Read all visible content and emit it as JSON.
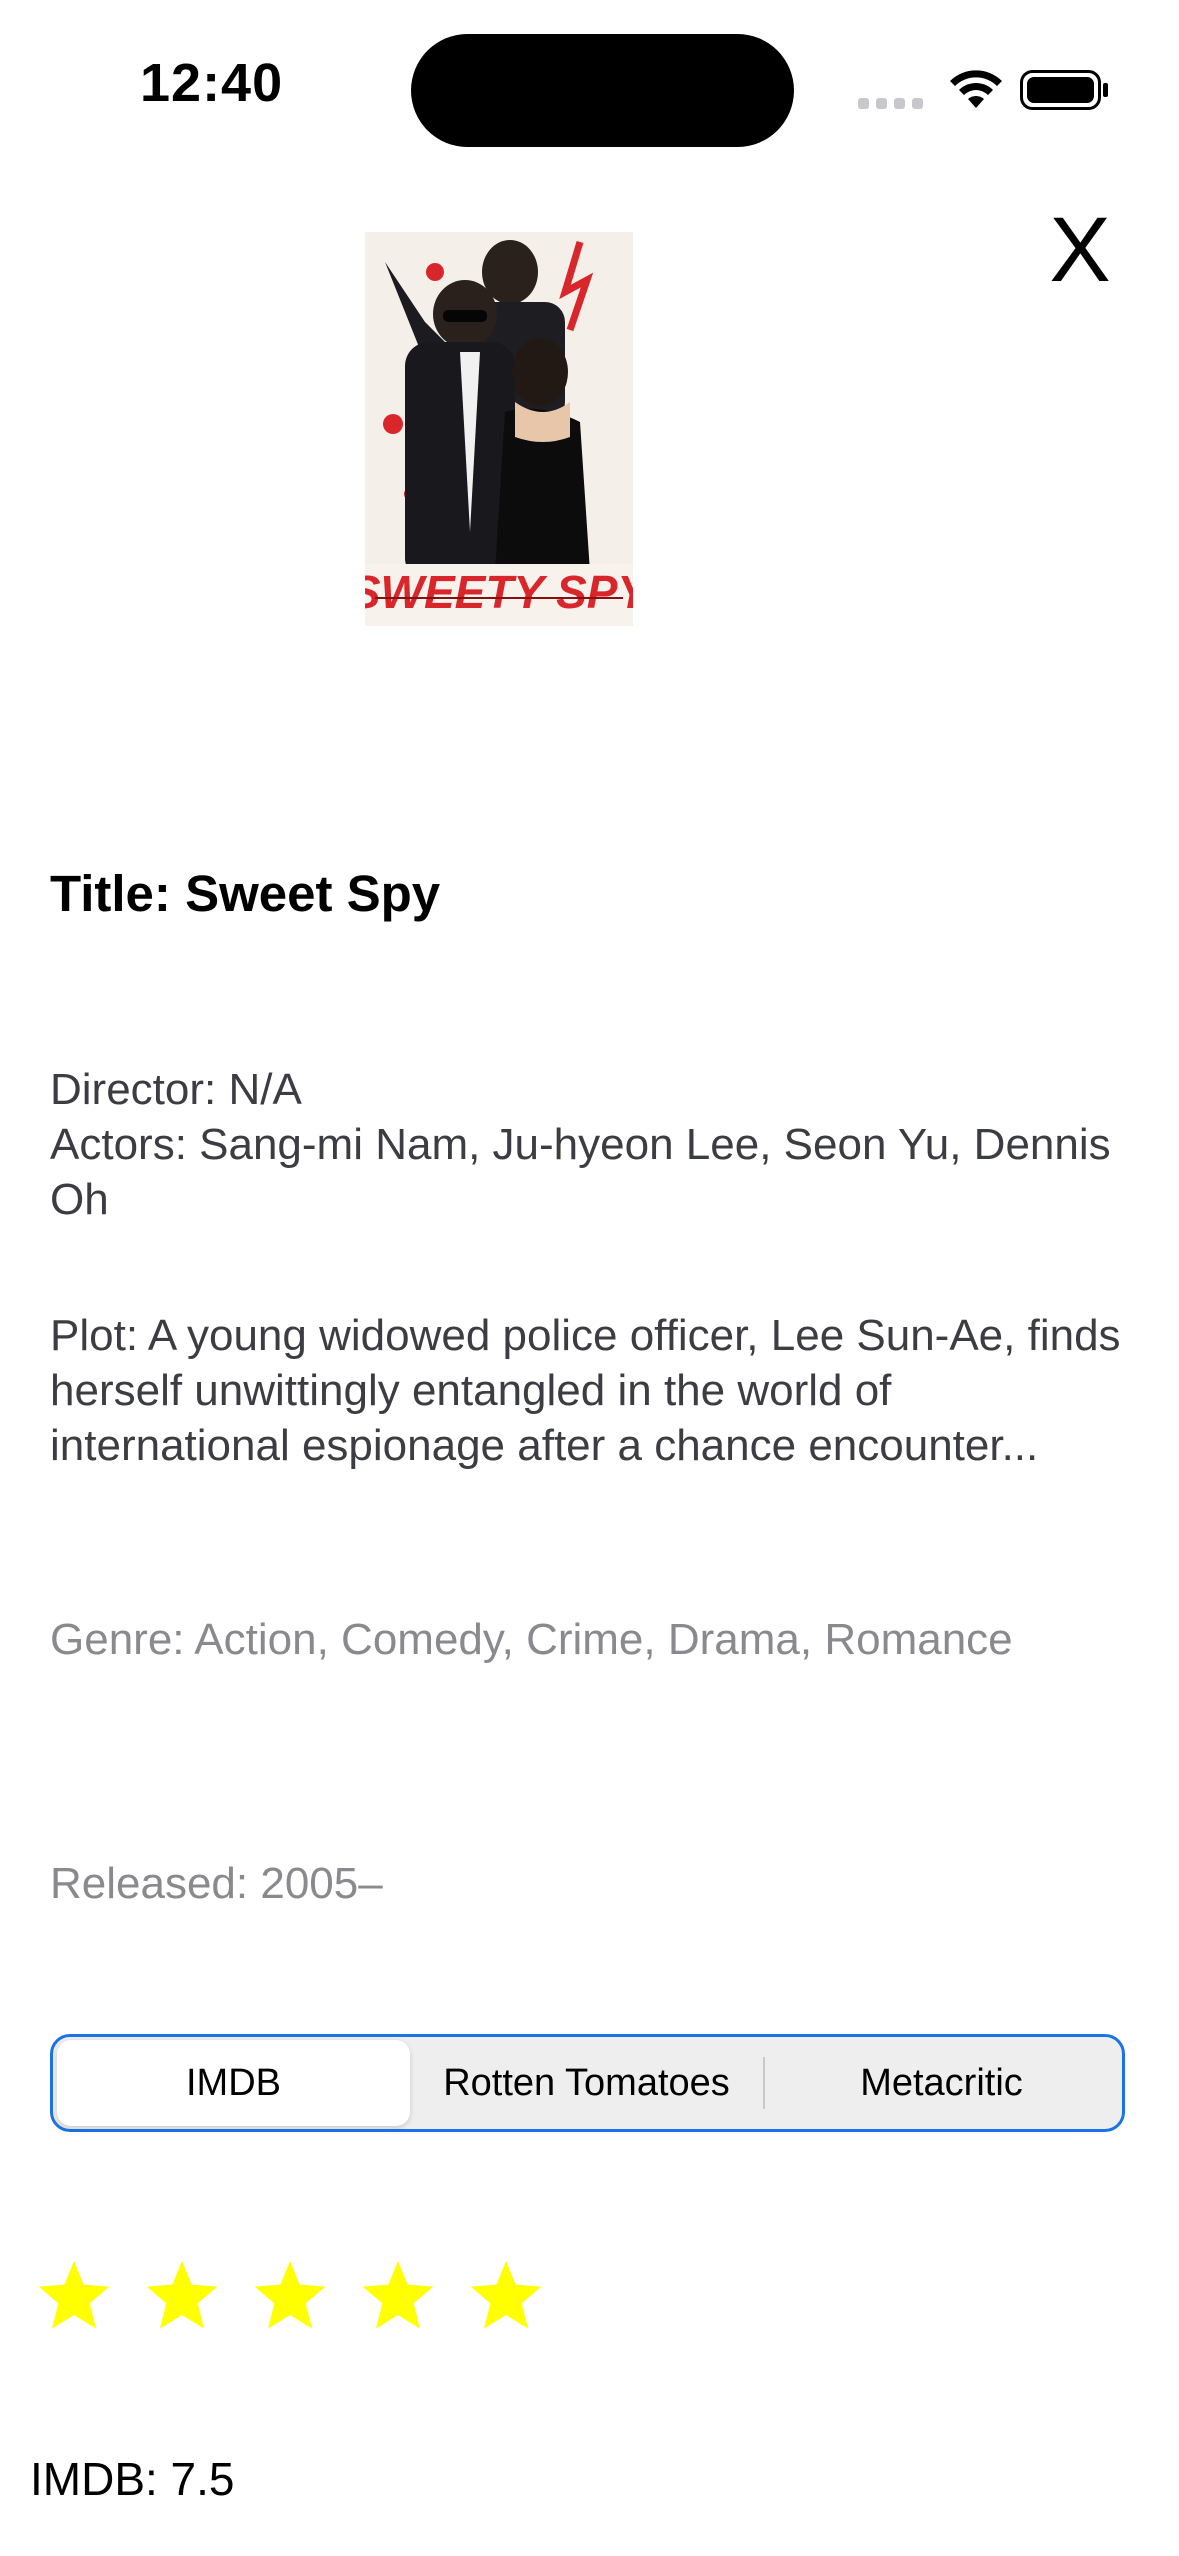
{
  "status_bar": {
    "time": "12:40"
  },
  "close": {
    "label": "X"
  },
  "poster": {
    "title_art": "SWEETY SPY"
  },
  "movie": {
    "title": "Title: Sweet Spy",
    "director": "Director: N/A",
    "actors": "Actors: Sang-mi Nam, Ju-hyeon Lee, Seon Yu, Dennis Oh",
    "plot": "Plot: A young widowed police officer, Lee Sun-Ae, finds herself unwittingly entangled in the world of international espionage after a chance encounter...",
    "genre": "Genre: Action, Comedy, Crime, Drama, Romance",
    "released": "Released: 2005–"
  },
  "ratings_tabs": {
    "items": [
      "IMDB",
      "Rotten Tomatoes",
      "Metacritic"
    ],
    "selected": "IMDB"
  },
  "stars": {
    "count": 5,
    "filled": 5,
    "color": "#ffff00"
  },
  "rating": {
    "text": "IMDB: 7.5"
  },
  "colors": {
    "segment_border": "#1a73e8",
    "secondary_text": "#8a8a8e"
  }
}
